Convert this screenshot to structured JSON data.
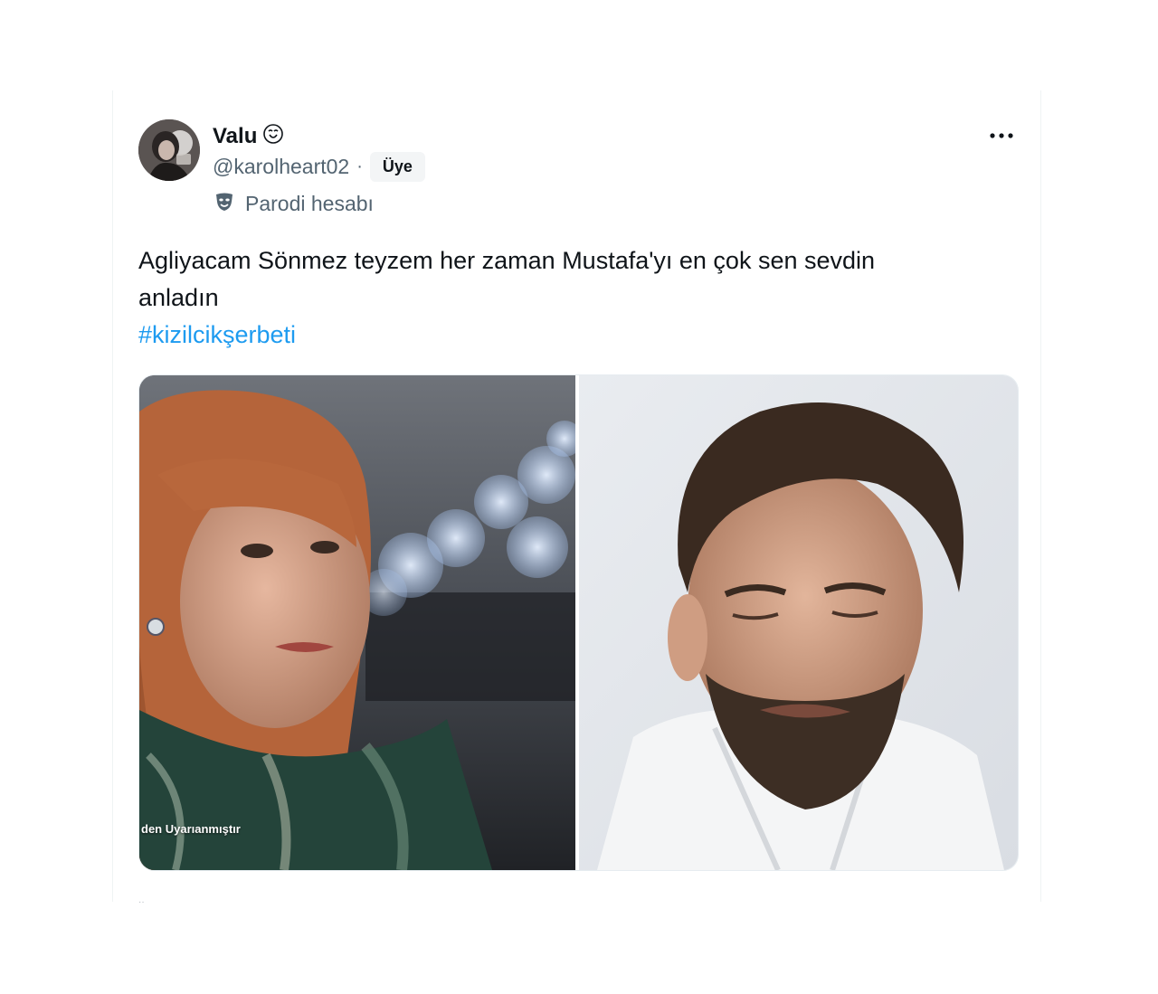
{
  "tweet": {
    "author_name": "Valu",
    "author_handle": "@karolheart02",
    "separator": "·",
    "member_badge": "Üye",
    "parody_label": "Parodi hesabı",
    "text_line1": "Agliyacam Sönmez teyzem her zaman Mustafa'yı en çok sen sevdin",
    "text_line2": "anladın",
    "hashtag": "#kizilcikşerbeti",
    "more_icon": "more-horizontal-icon",
    "verified_icon": "parody-badge-icon",
    "parody_icon": "theater-mask-icon"
  },
  "media": {
    "left_subtitle": "den Uyarıanmıştır"
  },
  "colors": {
    "text_primary": "#0f1419",
    "text_secondary": "#536471",
    "link": "#1d9bf0"
  }
}
